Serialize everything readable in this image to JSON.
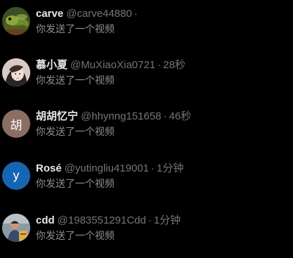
{
  "conversations": [
    {
      "display_name": "carve",
      "handle": "@carve44880",
      "separator": "·",
      "time": "",
      "preview": "你发送了一个视频",
      "avatar_icon": "lizard-photo-avatar",
      "avatar_letter": ""
    },
    {
      "display_name": "慕小夏",
      "handle": "@MuXiaoXia0721",
      "separator": "·",
      "time": "28秒",
      "preview": "你发送了一个视频",
      "avatar_icon": "person-photo-avatar",
      "avatar_letter": ""
    },
    {
      "display_name": "胡胡忆宁",
      "handle": "@hhynng151658",
      "separator": "·",
      "time": "46秒",
      "preview": "你发送了一个视频",
      "avatar_icon": "letter-avatar",
      "avatar_letter": "胡",
      "avatar_color": "#8a6e64"
    },
    {
      "display_name": "Rosé",
      "handle": "@yutingliu419001",
      "separator": "·",
      "time": "1分钟",
      "preview": "你发送了一个视频",
      "avatar_icon": "letter-avatar",
      "avatar_letter": "y",
      "avatar_color": "#1565b4"
    },
    {
      "display_name": "cdd",
      "handle": "@1983551291Cdd",
      "separator": "·",
      "time": "1分钟",
      "preview": "你发送了一个视频",
      "avatar_icon": "person-photo-avatar",
      "avatar_letter": ""
    }
  ]
}
